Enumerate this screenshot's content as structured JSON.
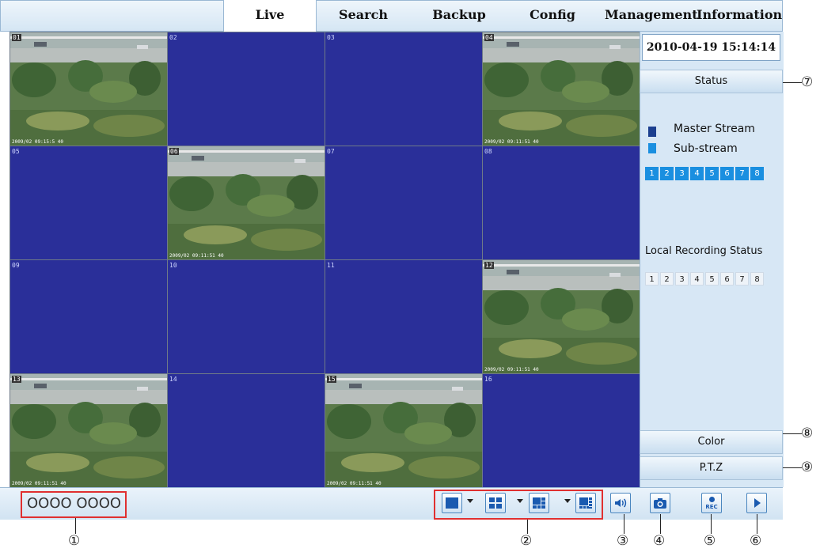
{
  "tabs": [
    {
      "label": "Live",
      "active": true
    },
    {
      "label": "Search",
      "active": false
    },
    {
      "label": "Backup",
      "active": false
    },
    {
      "label": "Config",
      "active": false
    },
    {
      "label": "Management",
      "active": false
    },
    {
      "label": "Information",
      "active": false
    }
  ],
  "datetime": "2010-04-19 15:14:14",
  "sidebar": {
    "status_label": "Status",
    "master_stream": "Master Stream",
    "sub_stream": "Sub-stream",
    "stream_channels": [
      "1",
      "2",
      "3",
      "4",
      "5",
      "6",
      "7",
      "8"
    ],
    "local_recording_label": "Local Recording Status",
    "recording_channels": [
      "1",
      "2",
      "3",
      "4",
      "5",
      "6",
      "7",
      "8"
    ],
    "color_label": "Color",
    "ptz_label": "P.T.Z"
  },
  "grid": {
    "cells": [
      {
        "num": "01",
        "camera": true,
        "timestamp": "2009/02 09:15:5 40"
      },
      {
        "num": "02",
        "camera": false
      },
      {
        "num": "03",
        "camera": false
      },
      {
        "num": "04",
        "camera": true,
        "timestamp": "2009/02 09:11:51 40"
      },
      {
        "num": "05",
        "camera": false
      },
      {
        "num": "06",
        "camera": true,
        "timestamp": "2009/02 09:11:51 40"
      },
      {
        "num": "07",
        "camera": false
      },
      {
        "num": "08",
        "camera": false
      },
      {
        "num": "09",
        "camera": false
      },
      {
        "num": "10",
        "camera": false
      },
      {
        "num": "11",
        "camera": false
      },
      {
        "num": "12",
        "camera": true,
        "timestamp": "2009/02 09:11:51 40"
      },
      {
        "num": "13",
        "camera": true,
        "timestamp": "2009/02 09:11:51 40"
      },
      {
        "num": "14",
        "camera": false
      },
      {
        "num": "15",
        "camera": true,
        "timestamp": "2009/02 09:11:51 40"
      },
      {
        "num": "16",
        "camera": false
      }
    ]
  },
  "bottom": {
    "channel_circles": "OOOO OOOO",
    "rec_label": "REC"
  },
  "callouts": [
    "①",
    "②",
    "③",
    "④",
    "⑤",
    "⑥",
    "⑦",
    "⑧",
    "⑨"
  ],
  "colors": {
    "blue_cell": "#2a2f99",
    "active_channel": "#1a8fe0",
    "callout_box": "#e03030"
  }
}
